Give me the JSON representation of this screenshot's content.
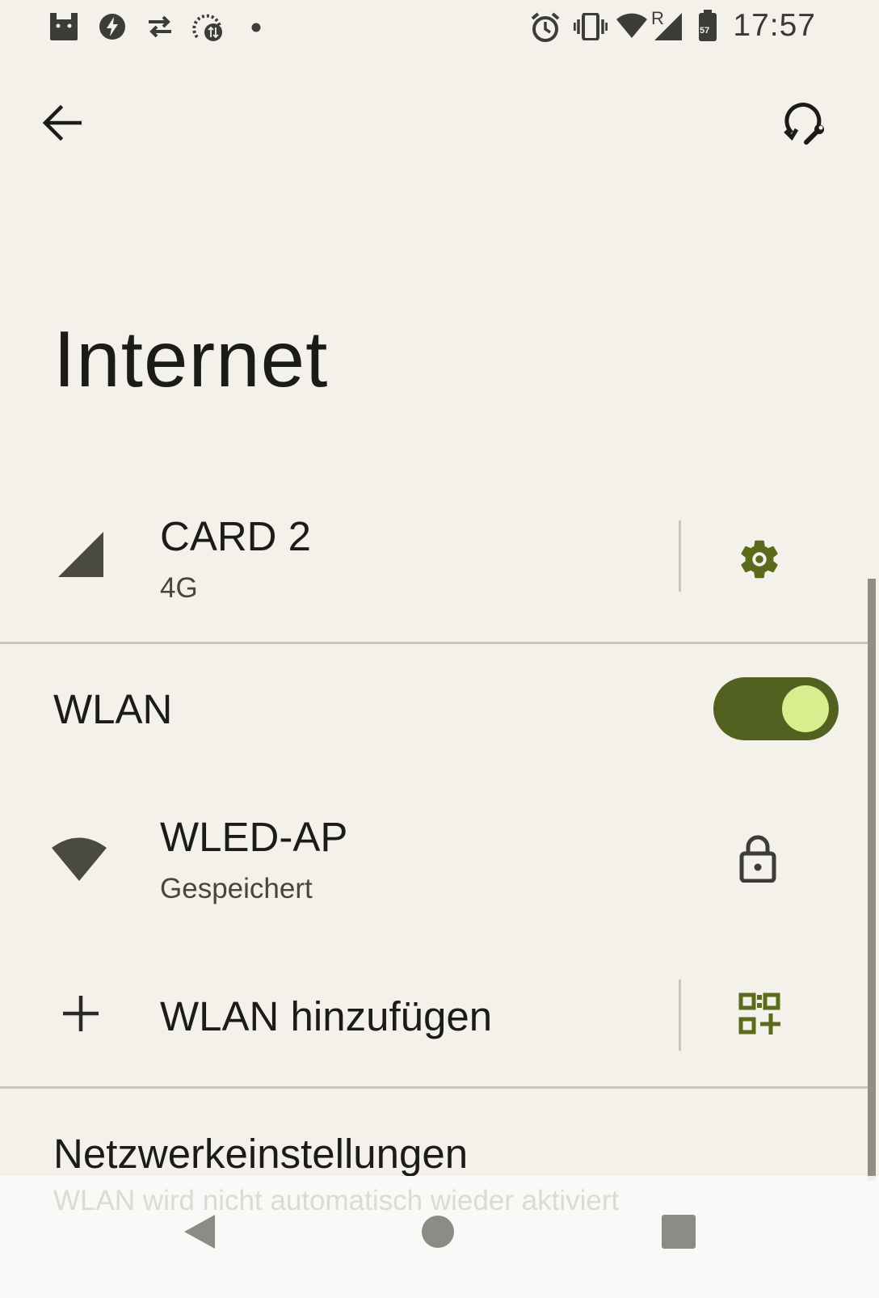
{
  "status_bar": {
    "time": "17:57",
    "roaming_indicator": "R",
    "battery_level": "57",
    "left_icons": [
      "android-debug-icon",
      "flash-icon",
      "data-transfer-icon",
      "sync-status-icon",
      "dot-icon"
    ],
    "right_icons": [
      "alarm-icon",
      "vibrate-icon",
      "wifi-icon",
      "cellular-signal-icon",
      "battery-icon"
    ]
  },
  "app_bar": {
    "back_icon": "arrow-back-icon",
    "reset_icon": "network-reset-icon"
  },
  "page": {
    "title": "Internet"
  },
  "mobile": {
    "name": "CARD 2",
    "network_type": "4G",
    "signal_icon": "cellular-signal-icon",
    "settings_icon": "gear-icon"
  },
  "wlan": {
    "label": "WLAN",
    "enabled": true
  },
  "networks": [
    {
      "name": "WLED-AP",
      "status": "Gespeichert",
      "icon": "wifi-icon",
      "secured_icon": "lock-icon"
    }
  ],
  "add_network": {
    "label": "WLAN hinzufügen",
    "icon": "plus-icon",
    "qr_icon": "qr-code-add-icon"
  },
  "network_settings": {
    "title": "Netzwerkeinstellungen",
    "subtitle": "WLAN wird nicht automatisch wieder aktiviert"
  },
  "colors": {
    "background": "#f3f1ea",
    "accent": "#536120",
    "toggle_thumb": "#d8ee8e",
    "icon_accent": "#5a6b1c"
  },
  "nav_bar": {
    "back_icon": "nav-back-icon",
    "home_icon": "nav-home-icon",
    "recents_icon": "nav-recents-icon"
  }
}
